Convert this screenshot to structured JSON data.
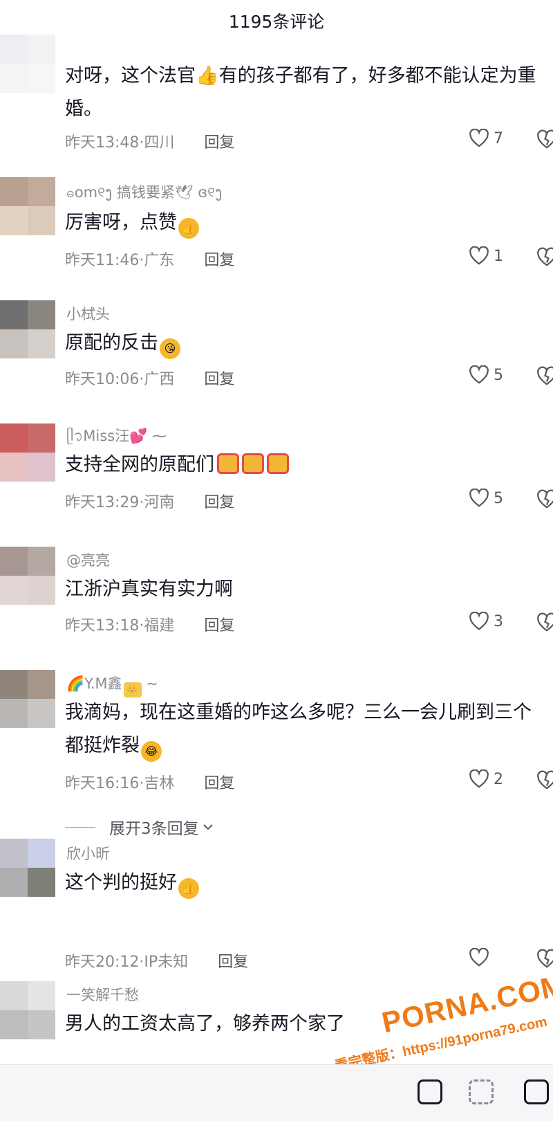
{
  "header": {
    "title": "1195条评论"
  },
  "comments": [
    {
      "user": "",
      "text": "对呀，这个法官👍有的孩子都有了，好多都不能认定为重婚。",
      "time": "昨天13:48·四川",
      "reply": "回复",
      "likes": "7"
    },
    {
      "user": "ဓom୧ງ 搞钱要紧🕊 ɞ୧ງ",
      "text": "厉害呀，点赞",
      "time": "昨天11:46·广东",
      "reply": "回复",
      "likes": "1"
    },
    {
      "user": "小栻头",
      "text": "原配的反击",
      "time": "昨天10:06·广西",
      "reply": "回复",
      "likes": "5"
    },
    {
      "user": "ᥫ᭡Miss汪💕 ⁓",
      "text": "支持全网的原配们",
      "time": "昨天13:29·河南",
      "reply": "回复",
      "likes": "5"
    },
    {
      "user": "@亮亮",
      "text": "江浙沪真实有实力啊",
      "time": "昨天13:18·福建",
      "reply": "回复",
      "likes": "3"
    },
    {
      "user": "🌈Y.M鑫",
      "text": "我滴妈，现在这重婚的咋这么多呢？三么一会儿刷到三个都挺炸裂",
      "time": "昨天16:16·吉林",
      "reply": "回复",
      "likes": "2"
    },
    {
      "user": "欣小昕",
      "text": "这个判的挺好",
      "time": "昨天20:12·IP未知",
      "reply": "回复",
      "likes": ""
    },
    {
      "user": "一笑解千愁",
      "text": "男人的工资太高了，够养两个家了",
      "time": "",
      "reply": "",
      "likes": ""
    }
  ],
  "expand_replies": "展开3条回复",
  "watermark": {
    "brand": "PORNA.COM",
    "sub": "看完整版：https://91porna79.com"
  },
  "colors": {
    "accent": "#f07a16",
    "text": "#161823",
    "muted": "#8a8b91"
  }
}
